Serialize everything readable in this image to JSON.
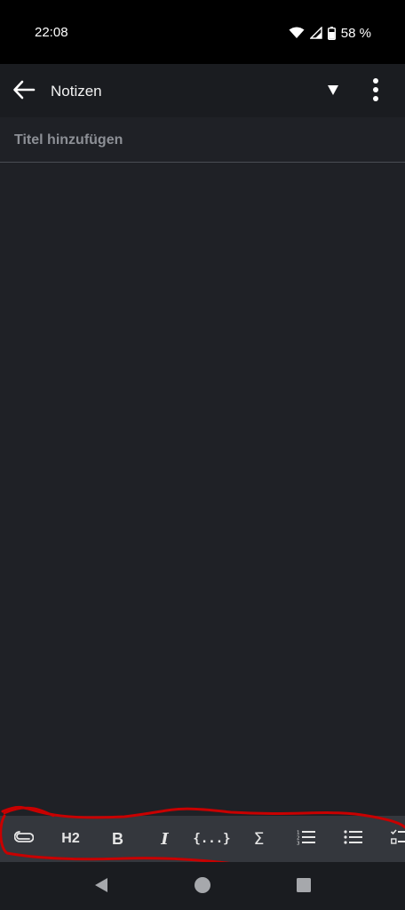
{
  "status_bar": {
    "time": "22:08",
    "battery_percent": "58 %",
    "icons": [
      "wifi-icon",
      "signal-icon",
      "battery-icon"
    ]
  },
  "app_bar": {
    "title": "Notizen",
    "icons": [
      "back-arrow-icon",
      "dropdown-triangle-icon",
      "more-vert-icon"
    ]
  },
  "editor": {
    "title_placeholder": "Titel hinzufügen",
    "title_value": ""
  },
  "toolbar": {
    "heading_label": "H2",
    "bold_label": "B",
    "italic_label": "I",
    "code_label": "{...}",
    "math_label": "Σ",
    "icons": [
      "attachment-icon",
      "numbered-list-icon",
      "bullet-list-icon",
      "checklist-icon"
    ]
  },
  "nav_bar": {
    "icons": [
      "back-triangle-icon",
      "home-circle-icon",
      "recents-square-icon"
    ]
  },
  "colors": {
    "background": "#1f2126",
    "app_bar": "#1a1c20",
    "toolbar": "#34373d",
    "annotation": "#cc0000"
  }
}
